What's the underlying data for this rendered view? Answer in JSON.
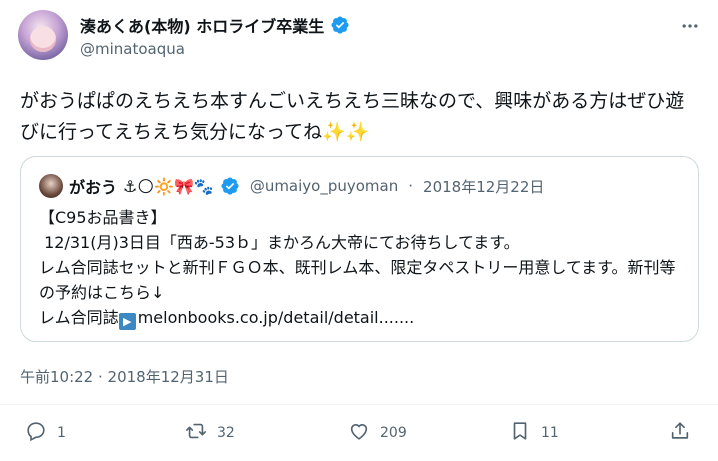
{
  "author": {
    "display_name": "湊あくあ(本物) ホロライブ卒業生",
    "handle": "@minatoaqua",
    "avatar_icon": "avatar-image",
    "verified_icon": "verified-badge-icon"
  },
  "tweet": {
    "text": "がおうぱぱのえちえち本すんごいえちえち三昧なので、興味がある方はぜひ遊びに行ってえちえち気分になってね",
    "sparkles": "✨✨"
  },
  "quote": {
    "name": "がおう",
    "emojis": "⚓🌕🔆🎀🐾",
    "handle": "@umaiyo_puyoman",
    "separator": "·",
    "date": "2018年12月22日",
    "line1": "【C95お品書き】",
    "line2": " 12/31(月)3日目「西あ-53ｂ」まかろん大帝にてお待ちしてます。",
    "line3": "レム合同誌セットと新刊ＦＧＯ本、既刊レム本、限定タペストリー用意してます。新刊等の予約はこちら↓",
    "line4_prefix": "レム合同誌",
    "play_glyph": "▶",
    "link": "melonbooks.co.jp/detail/detail.......",
    "verified_color": "#1d9bf0"
  },
  "timestamp": "午前10:22 · 2018年12月31日",
  "actions": {
    "reply_count": "1",
    "retweet_count": "32",
    "like_count": "209",
    "bookmark_count": "11",
    "icons": [
      "reply-icon",
      "retweet-icon",
      "like-icon",
      "bookmark-icon",
      "share-icon"
    ]
  },
  "colors": {
    "text": "#0f1419",
    "secondary": "#536471",
    "border": "#cfd9de",
    "verified": "#1d9bf0"
  }
}
